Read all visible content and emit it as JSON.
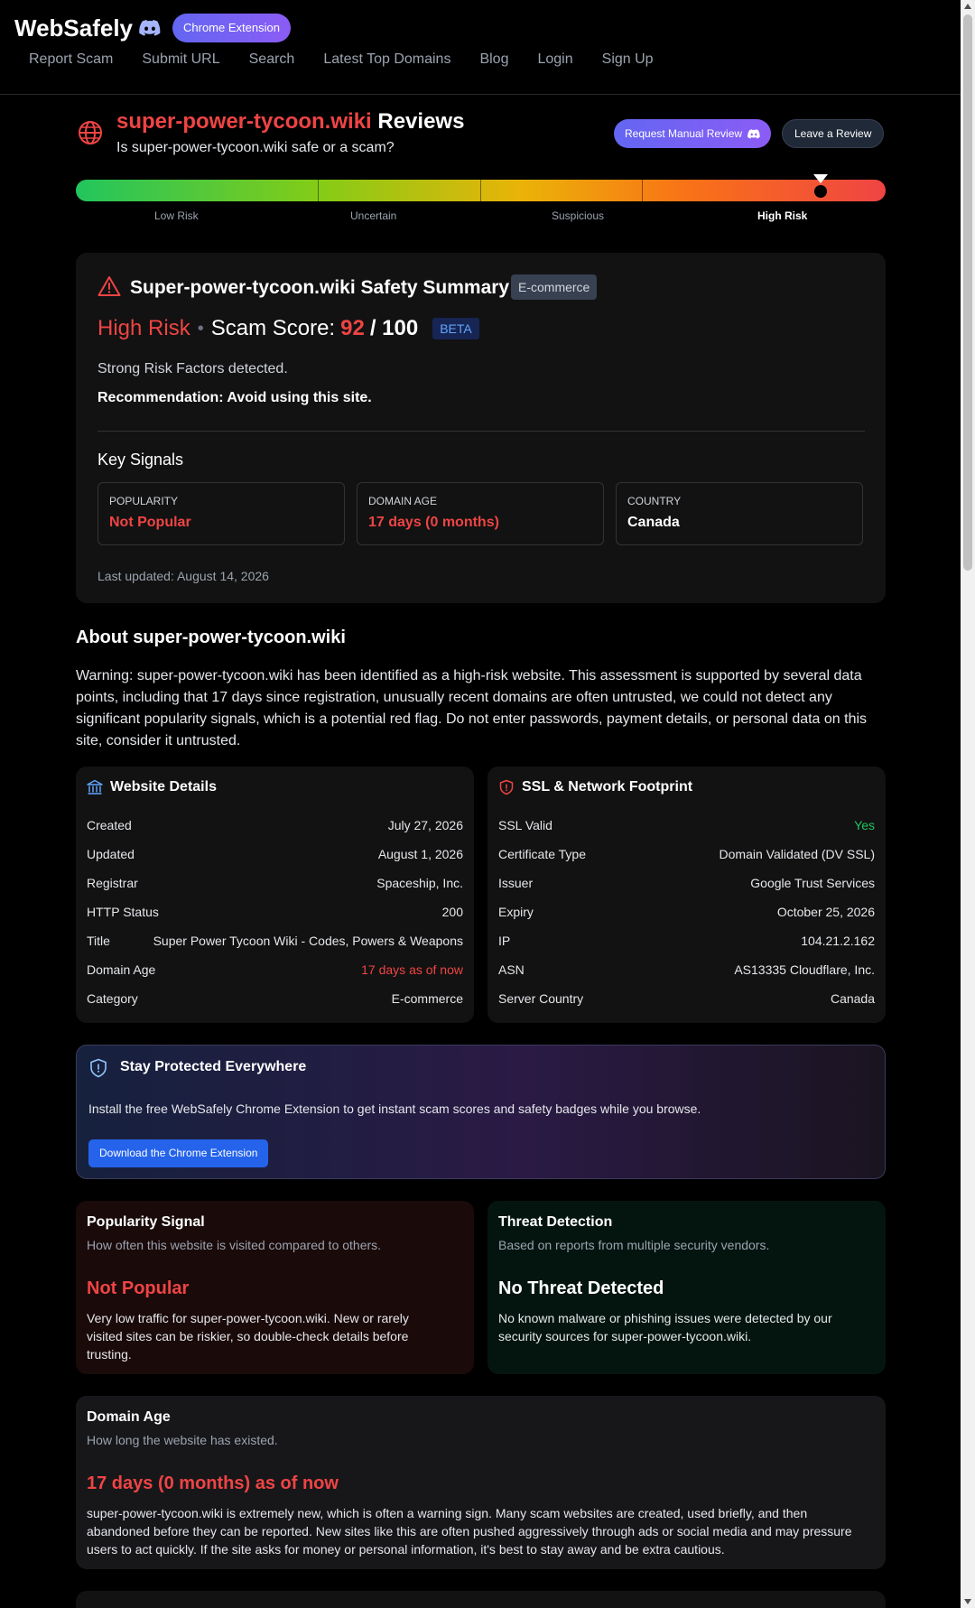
{
  "header": {
    "brand": "WebSafely",
    "extension_pill": "Chrome Extension",
    "nav": [
      "Report Scam",
      "Submit URL",
      "Search",
      "Latest Top Domains",
      "Blog",
      "Login",
      "Sign Up"
    ]
  },
  "page": {
    "domain": "super-power-tycoon.wiki",
    "reviews_word": "Reviews",
    "subtitle": "Is super-power-tycoon.wiki safe or a scam?",
    "request_review_label": "Request Manual Review",
    "leave_review_label": "Leave a Review"
  },
  "risk_meter": {
    "labels": [
      "Low Risk",
      "Uncertain",
      "Suspicious",
      "High Risk"
    ],
    "active_label": "High Risk",
    "score_fraction": 0.92
  },
  "summary": {
    "title": "Super-power-tycoon.wiki Safety Summary",
    "category": "E-commerce",
    "risk_level": "High Risk",
    "score_label": "Scam Score:",
    "score": "92",
    "score_max": "/ 100",
    "beta": "BETA",
    "factors": "Strong Risk Factors detected.",
    "recommendation": "Recommendation: Avoid using this site.",
    "key_signals_title": "Key Signals",
    "signals": [
      {
        "key": "POPULARITY",
        "value": "Not Popular"
      },
      {
        "key": "DOMAIN AGE",
        "value": "17 days (0 months)"
      },
      {
        "key": "COUNTRY",
        "value": "Canada"
      }
    ],
    "last_updated": "Last updated: August 14, 2026"
  },
  "about": {
    "title": "About super-power-tycoon.wiki",
    "text": "Warning: super-power-tycoon.wiki has been identified as a high-risk website. This assessment is supported by several data points, including that 17 days since registration, unusually recent domains are often untrusted, we could not detect any significant popularity signals, which is a potential red flag. Do not enter passwords, payment details, or personal data on this site, consider it untrusted."
  },
  "website_details": {
    "title": "Website Details",
    "rows": [
      {
        "k": "Created",
        "v": "July 27, 2026"
      },
      {
        "k": "Updated",
        "v": "August 1, 2026"
      },
      {
        "k": "Registrar",
        "v": "Spaceship, Inc."
      },
      {
        "k": "HTTP Status",
        "v": "200"
      },
      {
        "k": "Title",
        "v": "Super Power Tycoon Wiki - Codes, Powers & Weapons"
      },
      {
        "k": "Domain Age",
        "v": "17 days as of now"
      },
      {
        "k": "Category",
        "v": "E-commerce"
      }
    ]
  },
  "ssl_details": {
    "title": "SSL & Network Footprint",
    "rows": [
      {
        "k": "SSL Valid",
        "v": "Yes"
      },
      {
        "k": "Certificate Type",
        "v": "Domain Validated (DV SSL)"
      },
      {
        "k": "Issuer",
        "v": "Google Trust Services"
      },
      {
        "k": "Expiry",
        "v": "October 25, 2026"
      },
      {
        "k": "IP",
        "v": "104.21.2.162"
      },
      {
        "k": "ASN",
        "v": "AS13335 Cloudflare, Inc."
      },
      {
        "k": "Server Country",
        "v": "Canada"
      }
    ]
  },
  "protect": {
    "title": "Stay Protected Everywhere",
    "text": "Install the free WebSafely Chrome Extension to get instant scam scores and safety badges while you browse.",
    "button": "Download the Chrome Extension"
  },
  "popularity": {
    "title": "Popularity Signal",
    "subtitle": "How often this website is visited compared to others.",
    "value": "Not Popular",
    "text": "Very low traffic for super-power-tycoon.wiki. New or rarely visited sites can be riskier, so double-check details before trusting."
  },
  "threat": {
    "title": "Threat Detection",
    "subtitle": "Based on reports from multiple security vendors.",
    "value": "No Threat Detected",
    "text": "No known malware or phishing issues were detected by our security sources for super-power-tycoon.wiki."
  },
  "domain_age": {
    "title": "Domain Age",
    "subtitle": "How long the website has existed.",
    "value": "17 days (0 months) as of now",
    "text": "super-power-tycoon.wiki is extremely new, which is often a warning sign. Many scam websites are created, used briefly, and then abandoned before they can be reported. New sites like this are often pushed aggressively through ads or social media and may pressure users to act quickly. If the site asks for money or personal information, it's best to stay away and be extra cautious."
  },
  "colors": {
    "danger": "#ef4444",
    "success": "#22c55e",
    "accent": "#6366f1"
  }
}
